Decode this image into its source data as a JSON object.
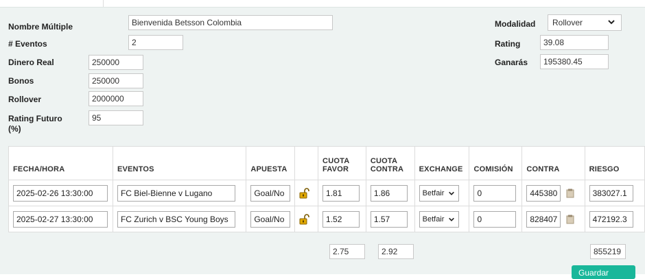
{
  "form": {
    "nombre_label": "Nombre Múltiple",
    "nombre_value": "Bienvenida Betsson Colombia",
    "eventos_label": "# Eventos",
    "eventos_value": "2",
    "dinero_label": "Dinero Real",
    "dinero_value": "250000",
    "bonos_label": "Bonos",
    "bonos_value": "250000",
    "rollover_label": "Rollover",
    "rollover_value": "2000000",
    "rating_futuro_label": "Rating Futuro (%)",
    "rating_futuro_value": "95",
    "modalidad_label": "Modalidad",
    "modalidad_value": "Rollover",
    "rating_label": "Rating",
    "rating_value": "39.08",
    "ganaras_label": "Ganarás",
    "ganaras_value": "195380.45"
  },
  "table": {
    "headers": {
      "fecha": "FECHA/HORA",
      "eventos": "EVENTOS",
      "apuesta": "APUESTA",
      "cuota_favor": "CUOTA FAVOR",
      "cuota_contra": "CUOTA CONTRA",
      "exchange": "EXCHANGE",
      "comision": "COMISIÓN",
      "contra": "CONTRA",
      "riesgo": "RIESGO"
    },
    "rows": [
      {
        "fecha": "2025-02-26 13:30:00",
        "evento": "FC Biel-Bienne v Lugano",
        "apuesta": "Goal/No",
        "cuota_favor": "1.81",
        "cuota_contra": "1.86",
        "exchange": "Betfair",
        "comision": "0",
        "contra": "445380",
        "riesgo": "383027.1"
      },
      {
        "fecha": "2025-02-27 13:30:00",
        "evento": "FC Zurich v BSC Young Boys",
        "apuesta": "Goal/No",
        "cuota_favor": "1.52",
        "cuota_contra": "1.57",
        "exchange": "Betfair",
        "comision": "0",
        "contra": "828407",
        "riesgo": "472192.3"
      }
    ],
    "totals": {
      "cuota_favor": "2.75",
      "cuota_contra": "2.92",
      "riesgo": "855219"
    }
  },
  "actions": {
    "save_label": "Guardar"
  },
  "icons": {
    "lock": "unlock-icon",
    "clipboard": "clipboard-icon",
    "chevron": "chevron-down-icon"
  },
  "colors": {
    "panel_bg": "#eef3f2",
    "accent": "#19b79a",
    "lock": "#e0a800"
  }
}
